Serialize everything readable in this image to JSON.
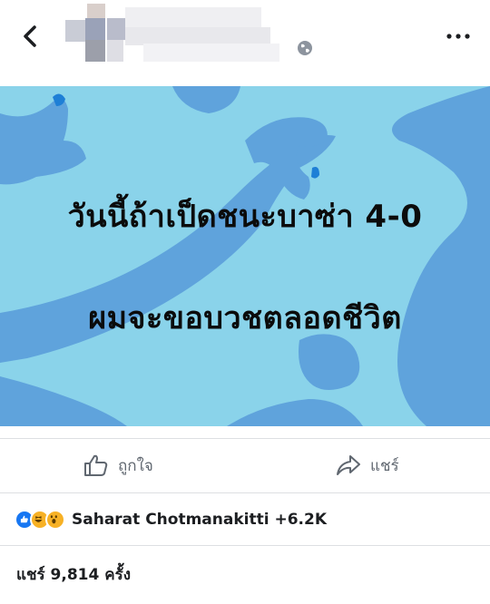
{
  "header": {
    "back_icon": "chevron-left-icon",
    "author_name_blurred": true,
    "privacy_icon": "globe-icon",
    "more_icon": "more-horizontal-icon"
  },
  "post": {
    "background_color": "#8ad3ea",
    "shape_color": "#5fa3dc",
    "line1": "วันนี้ถ้าเป็ดชนะบาซ่า 4-0",
    "line2": "ผมจะขอบวชตลอดชีวิต"
  },
  "actions": {
    "like_label": "ถูกใจ",
    "share_label": "แชร์",
    "like_icon": "thumbs-up-outline-icon",
    "share_icon": "share-arrow-icon"
  },
  "reactions": {
    "icons": [
      "like-reaction-icon",
      "haha-reaction-icon",
      "wow-reaction-icon"
    ],
    "summary": "Saharat Chotmanakitti +6.2K"
  },
  "shares": {
    "text": "แชร์ 9,814 ครั้ง"
  }
}
